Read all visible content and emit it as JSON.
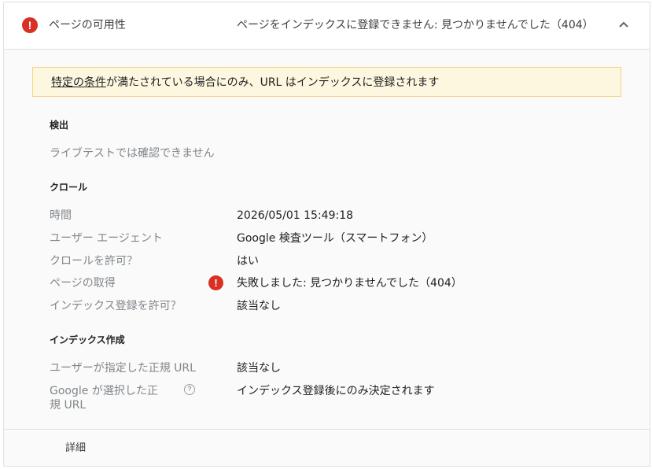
{
  "header": {
    "title": "ページの可用性",
    "status": "ページをインデックスに登録できません: 見つかりませんでした（404）"
  },
  "warning": {
    "link_text": "特定の条件",
    "text": "が満たされている場合にのみ、URL はインデックスに登録されます"
  },
  "detection": {
    "title": "検出",
    "note": "ライブテストでは確認できません"
  },
  "crawl": {
    "title": "クロール",
    "rows": [
      {
        "label": "時間",
        "value": "2026/05/01 15:49:18"
      },
      {
        "label": "ユーザー エージェント",
        "value": "Google 検査ツール（スマートフォン）"
      },
      {
        "label": "クロールを許可？",
        "value": "はい"
      },
      {
        "label": "ページの取得",
        "value": "失敗しました: 見つかりませんでした（404）"
      },
      {
        "label": "インデックス登録を許可？",
        "value": "該当なし"
      }
    ]
  },
  "indexing": {
    "title": "インデックス作成",
    "rows": [
      {
        "label": "ユーザーが指定した正規 URL",
        "value": "該当なし"
      },
      {
        "label": "Google が選択した正規 URL",
        "value": "インデックス登録後にのみ決定されます"
      }
    ]
  },
  "footer": {
    "details_label": "詳細"
  },
  "icons": {
    "error": "error-icon",
    "help": "help-icon",
    "chevron": "chevron-up-icon"
  },
  "colors": {
    "error": "#d93025",
    "warning_bg": "#fef7e0",
    "warning_border": "#f6d279"
  }
}
